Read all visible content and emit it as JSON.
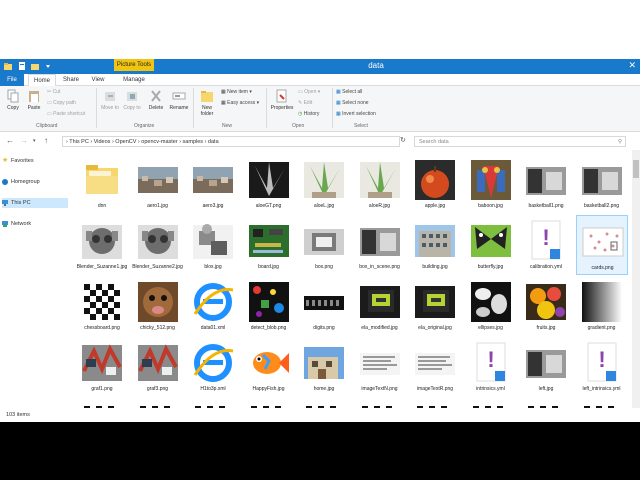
{
  "window": {
    "title": "data",
    "contextual_tab": "Picture Tools",
    "close_glyph": "✕"
  },
  "tabs": {
    "file": "File",
    "home": "Home",
    "share": "Share",
    "view": "View",
    "manage": "Manage"
  },
  "ribbon": {
    "clipboard": {
      "label": "Clipboard",
      "copy": "Copy",
      "paste": "Paste",
      "cut": "Cut",
      "copy_path": "Copy path",
      "paste_shortcut": "Paste shortcut"
    },
    "organize": {
      "label": "Organize",
      "move_to": "Move to",
      "copy_to": "Copy to",
      "delete": "Delete",
      "rename": "Rename"
    },
    "new": {
      "label": "New",
      "new_folder": "New folder",
      "new_item": "New item ▾",
      "easy_access": "Easy access ▾"
    },
    "open": {
      "label": "Open",
      "properties": "Properties",
      "open": "Open ▾",
      "edit": "Edit",
      "history": "History"
    },
    "select": {
      "label": "Select",
      "select_all": "Select all",
      "select_none": "Select none",
      "invert": "Invert selection"
    }
  },
  "address": {
    "path": "›  This PC  ›  Videos  ›  OpenCV  ›  opencv-master  ›  samples  ›  data",
    "search_placeholder": "Search data"
  },
  "nav": {
    "favorites": "Favorites",
    "homegroup": "Homegroup",
    "this_pc": "This PC",
    "network": "Network"
  },
  "files": [
    {
      "name": "dnn",
      "kind": "folder"
    },
    {
      "name": "aero1.jpg",
      "kind": "photo"
    },
    {
      "name": "aero3.jpg",
      "kind": "photo"
    },
    {
      "name": "aloeGT.png",
      "kind": "aloegt"
    },
    {
      "name": "aloeL.jpg",
      "kind": "aloe"
    },
    {
      "name": "aloeR.jpg",
      "kind": "aloe"
    },
    {
      "name": "apple.jpg",
      "kind": "apple"
    },
    {
      "name": "baboon.jpg",
      "kind": "baboon"
    },
    {
      "name": "basketball1.png",
      "kind": "gray"
    },
    {
      "name": "basketball2.png",
      "kind": "gray"
    },
    {
      "name": "Blender_Suzanne1.jpg",
      "kind": "suzanne"
    },
    {
      "name": "Blender_Suzanne2.jpg",
      "kind": "suzanne"
    },
    {
      "name": "blox.jpg",
      "kind": "blox"
    },
    {
      "name": "board.jpg",
      "kind": "board"
    },
    {
      "name": "box.png",
      "kind": "box"
    },
    {
      "name": "box_in_scene.png",
      "kind": "gray"
    },
    {
      "name": "building.jpg",
      "kind": "building"
    },
    {
      "name": "butterfly.jpg",
      "kind": "butterfly"
    },
    {
      "name": "calibration.yml",
      "kind": "yml"
    },
    {
      "name": "cards.png",
      "kind": "cards"
    },
    {
      "name": "chessboard.png",
      "kind": "chess"
    },
    {
      "name": "chicky_512.png",
      "kind": "dog"
    },
    {
      "name": "data01.xml",
      "kind": "ie"
    },
    {
      "name": "detect_blob.png",
      "kind": "blob"
    },
    {
      "name": "digits.png",
      "kind": "digits"
    },
    {
      "name": "ela_modified.jpg",
      "kind": "ela"
    },
    {
      "name": "ela_original.jpg",
      "kind": "ela"
    },
    {
      "name": "ellipses.jpg",
      "kind": "ellipses"
    },
    {
      "name": "fruits.jpg",
      "kind": "fruits"
    },
    {
      "name": "gradient.png",
      "kind": "gradient"
    },
    {
      "name": "graf1.png",
      "kind": "graf"
    },
    {
      "name": "graf3.png",
      "kind": "graf"
    },
    {
      "name": "H1to3p.xml",
      "kind": "ie"
    },
    {
      "name": "HappyFish.jpg",
      "kind": "fish"
    },
    {
      "name": "home.jpg",
      "kind": "home"
    },
    {
      "name": "imageTextN.png",
      "kind": "text"
    },
    {
      "name": "imageTextR.png",
      "kind": "text"
    },
    {
      "name": "intrinsics.yml",
      "kind": "yml"
    },
    {
      "name": "left.jpg",
      "kind": "gray"
    },
    {
      "name": "left_intrinsics.yml",
      "kind": "yml"
    },
    {
      "name": "",
      "kind": "chess"
    },
    {
      "name": "",
      "kind": "chess"
    },
    {
      "name": "",
      "kind": "chess"
    },
    {
      "name": "",
      "kind": "chess"
    },
    {
      "name": "",
      "kind": "chess"
    },
    {
      "name": "",
      "kind": "chess"
    },
    {
      "name": "",
      "kind": "chess"
    },
    {
      "name": "",
      "kind": "chess"
    },
    {
      "name": "",
      "kind": "chess"
    },
    {
      "name": "",
      "kind": "chess"
    }
  ],
  "selected_index": 19,
  "status": {
    "count": "103 items"
  },
  "colors": {
    "accent": "#1979ca",
    "context_tab": "#f1c40f",
    "selection": "#cce8ff"
  }
}
